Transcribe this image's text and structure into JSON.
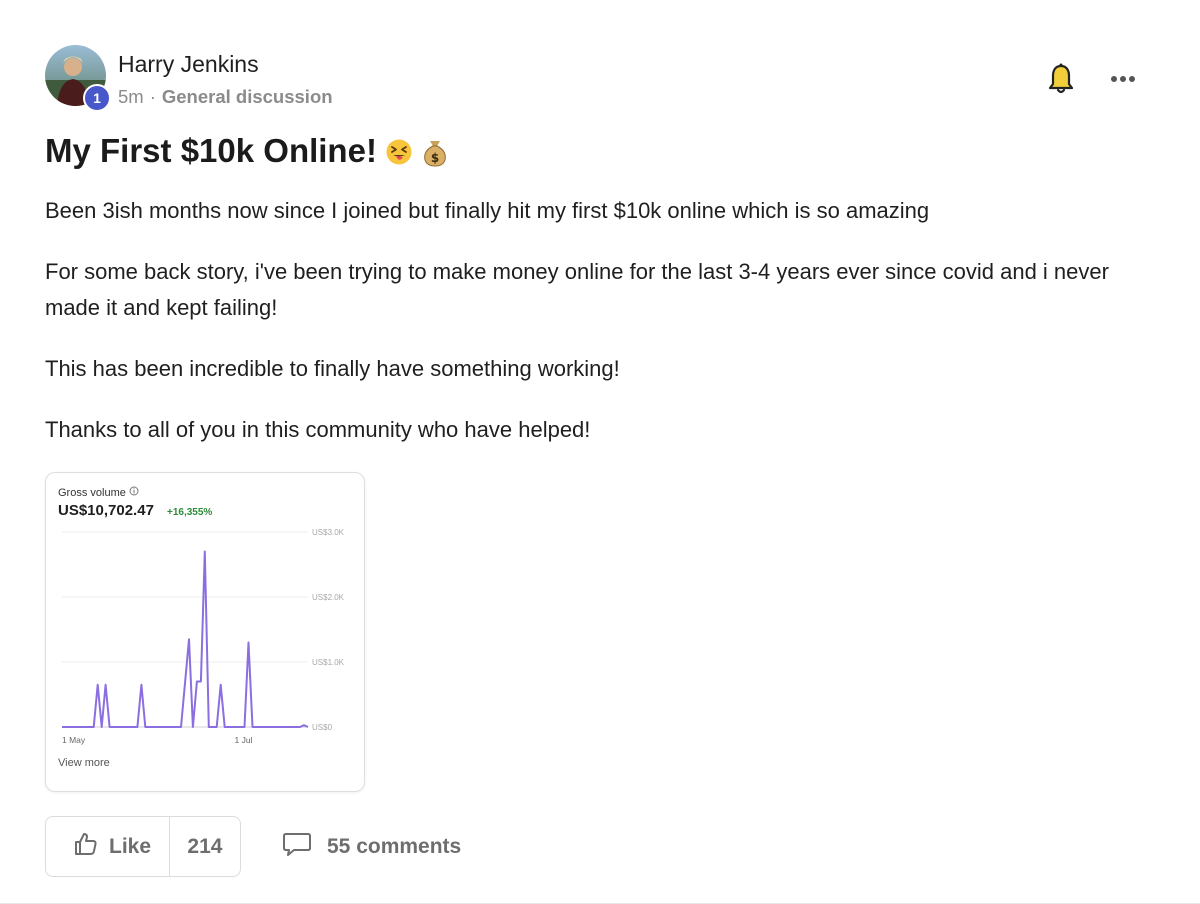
{
  "author": {
    "name": "Harry Jenkins",
    "level": "1",
    "time": "5m",
    "separator": "·",
    "category": "General discussion"
  },
  "post": {
    "title": "My First $10k Online!",
    "title_emojis": [
      "squinting-face-with-tongue",
      "money-bag"
    ],
    "paragraphs": [
      "Been 3ish months now since I joined but finally hit my first $10k online which is so amazing",
      "For some back story, i've been trying to make money online for the last 3-4 years ever since covid and i never made it and kept failing!",
      "This has been incredible to finally have something working!",
      "Thanks to all of you in this community who have helped!"
    ]
  },
  "attachment": {
    "label": "Gross volume",
    "amount": "US$10,702.47",
    "change": "+16,355%",
    "view_more": "View more"
  },
  "chart_data": {
    "type": "line",
    "title": "Gross volume",
    "x_tick_labels": [
      "1 May",
      "1 Jul"
    ],
    "y_tick_labels": [
      "US$0",
      "US$1.0K",
      "US$2.0K",
      "US$3.0K"
    ],
    "ylim": [
      0,
      3000
    ],
    "grid": true,
    "series": [
      {
        "color": "#8b6ee0",
        "points": [
          [
            0,
            0
          ],
          [
            8,
            0
          ],
          [
            9,
            650
          ],
          [
            10,
            0
          ],
          [
            11,
            650
          ],
          [
            12,
            0
          ],
          [
            19,
            0
          ],
          [
            20,
            650
          ],
          [
            21,
            0
          ],
          [
            30,
            0
          ],
          [
            32,
            1350
          ],
          [
            33,
            0
          ],
          [
            34,
            700
          ],
          [
            35,
            700
          ],
          [
            36,
            2700
          ],
          [
            37,
            0
          ],
          [
            39,
            0
          ],
          [
            40,
            650
          ],
          [
            41,
            0
          ],
          [
            46,
            0
          ],
          [
            47,
            1300
          ],
          [
            48,
            0
          ],
          [
            60,
            0
          ],
          [
            61,
            30
          ],
          [
            62,
            0
          ]
        ]
      }
    ]
  },
  "actions": {
    "like_label": "Like",
    "like_count": "214",
    "comments_label": "55 comments"
  },
  "icons": {
    "bell": "bell-icon",
    "more": "more-horizontal-icon",
    "like": "thumbs-up-icon",
    "comment": "comment-icon",
    "info": "info-icon"
  }
}
